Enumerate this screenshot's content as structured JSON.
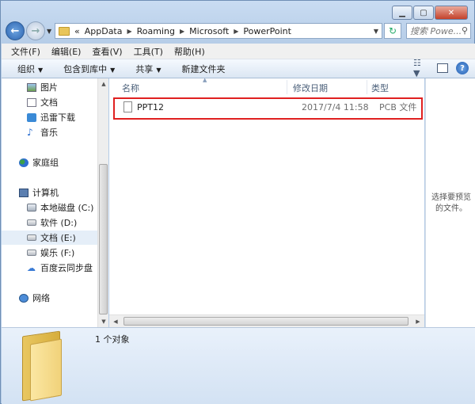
{
  "window": {
    "caption_buttons": [
      "minimize",
      "maximize",
      "close"
    ]
  },
  "nav": {
    "back_icon": "back-arrow-icon",
    "forward_icon": "forward-arrow-icon"
  },
  "address": {
    "crumbs": [
      "AppData",
      "Roaming",
      "Microsoft",
      "PowerPoint"
    ],
    "prefix": "«"
  },
  "search": {
    "placeholder": "搜索 Powe..."
  },
  "menu": {
    "items": [
      "文件(F)",
      "编辑(E)",
      "查看(V)",
      "工具(T)",
      "帮助(H)"
    ]
  },
  "toolbar": {
    "organize": "组织",
    "include": "包含到库中",
    "share": "共享",
    "new_folder": "新建文件夹"
  },
  "navpane": {
    "items": [
      {
        "label": "图片",
        "icon": "pictures-icon"
      },
      {
        "label": "文档",
        "icon": "documents-icon"
      },
      {
        "label": "迅雷下载",
        "icon": "download-icon"
      },
      {
        "label": "音乐",
        "icon": "music-icon"
      },
      {
        "label": "家庭组",
        "icon": "homegroup-icon"
      },
      {
        "label": "计算机",
        "icon": "computer-icon"
      },
      {
        "label": "本地磁盘 (C:)",
        "icon": "drive-c-icon"
      },
      {
        "label": "软件 (D:)",
        "icon": "drive-icon"
      },
      {
        "label": "文档 (E:)",
        "icon": "drive-icon"
      },
      {
        "label": "娱乐 (F:)",
        "icon": "drive-icon"
      },
      {
        "label": "百度云同步盘",
        "icon": "cloud-icon"
      },
      {
        "label": "网络",
        "icon": "network-icon"
      }
    ]
  },
  "filelist": {
    "columns": [
      "名称",
      "修改日期",
      "类型"
    ],
    "rows": [
      {
        "name": "PPT12",
        "modified": "2017/7/4 11:58",
        "type": "PCB 文件"
      }
    ]
  },
  "preview": {
    "text": "选择要预览的文件。"
  },
  "details": {
    "count": "1 个对象"
  }
}
